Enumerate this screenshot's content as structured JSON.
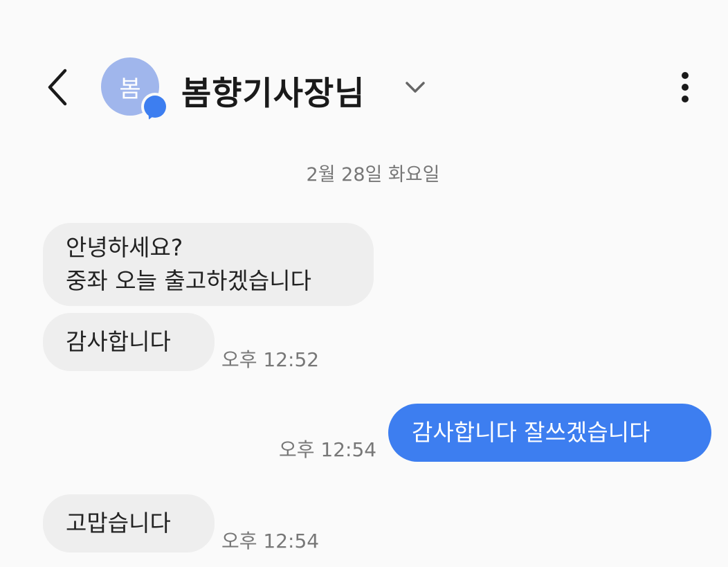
{
  "header": {
    "back_icon": "chevron-left-icon",
    "avatar_initial": "봄",
    "avatar_color": "#a0b6ec",
    "badge_icon": "chat-bubble-icon",
    "badge_color": "#3d7ef0",
    "contact_name": "봄향기사장님",
    "dropdown_icon": "chevron-down-icon",
    "more_icon": "more-vertical-icon"
  },
  "date_separator": "2월 28일 화요일",
  "messages": [
    {
      "direction": "incoming",
      "lines": [
        "안녕하세요?",
        "중좌 오늘 출고하겠습니다"
      ],
      "time": ""
    },
    {
      "direction": "incoming",
      "lines": [
        "감사합니다"
      ],
      "time": "오후 12:52"
    },
    {
      "direction": "outgoing",
      "lines": [
        "감사합니다 잘쓰겠습니다"
      ],
      "time": "오후 12:54"
    },
    {
      "direction": "incoming",
      "lines": [
        "고맙습니다"
      ],
      "time": "오후 12:54"
    }
  ],
  "colors": {
    "background": "#fafafa",
    "incoming_bubble": "#eeeeee",
    "outgoing_bubble": "#3d7ef0",
    "timestamp_text": "#777777"
  }
}
